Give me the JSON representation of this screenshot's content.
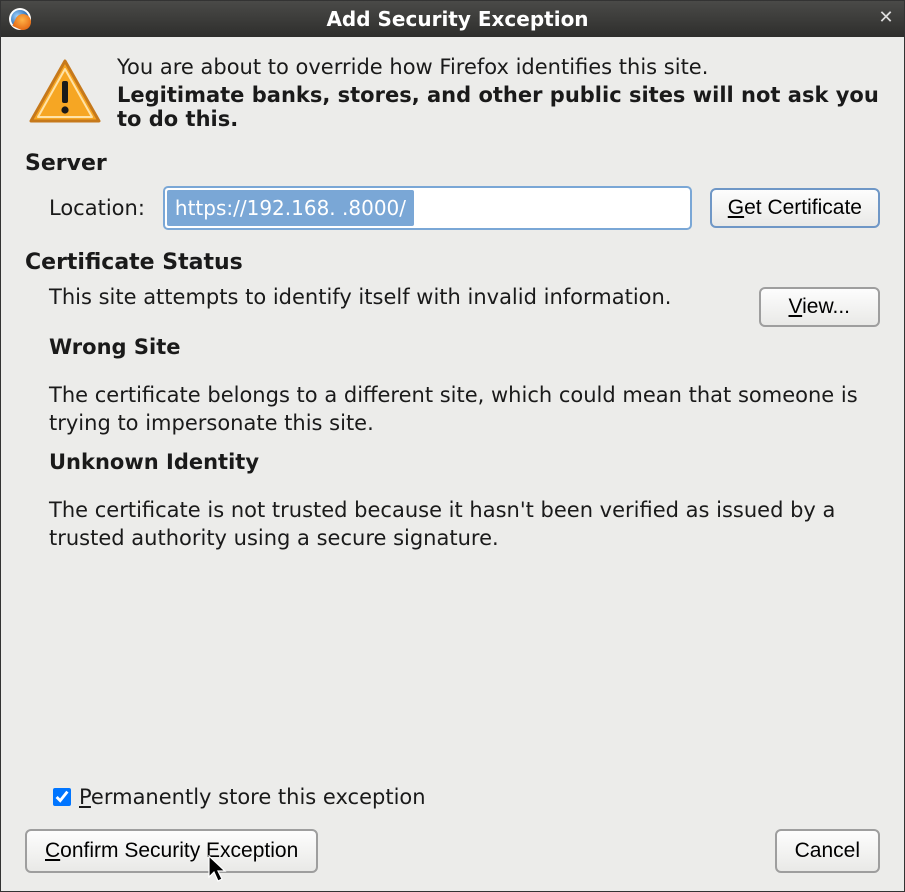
{
  "window": {
    "title": "Add Security Exception"
  },
  "header": {
    "line1": "You are about to override how Firefox identifies this site.",
    "line2": "Legitimate banks, stores, and other public sites will not ask you to do this."
  },
  "server": {
    "section_label": "Server",
    "location_label": "Location:",
    "url_value": "https://192.168.   .8000/",
    "get_cert_mnemonic": "G",
    "get_cert_rest": "et Certificate"
  },
  "status": {
    "section_label": "Certificate Status",
    "desc": "This site attempts to identify itself with invalid information.",
    "view_mnemonic": "V",
    "view_rest": "iew...",
    "wrong_site_h": "Wrong Site",
    "wrong_site_p": "The certificate belongs to a different site, which could mean that someone is trying to impersonate this site.",
    "unknown_h": "Unknown Identity",
    "unknown_p": "The certificate is not trusted because it hasn't been verified as issued by a trusted authority using a secure signature."
  },
  "perm": {
    "checked": true,
    "mnemonic": "P",
    "rest": "ermanently store this exception"
  },
  "footer": {
    "confirm_mnemonic": "C",
    "confirm_rest": "onfirm Security Exception",
    "cancel": "Cancel"
  }
}
